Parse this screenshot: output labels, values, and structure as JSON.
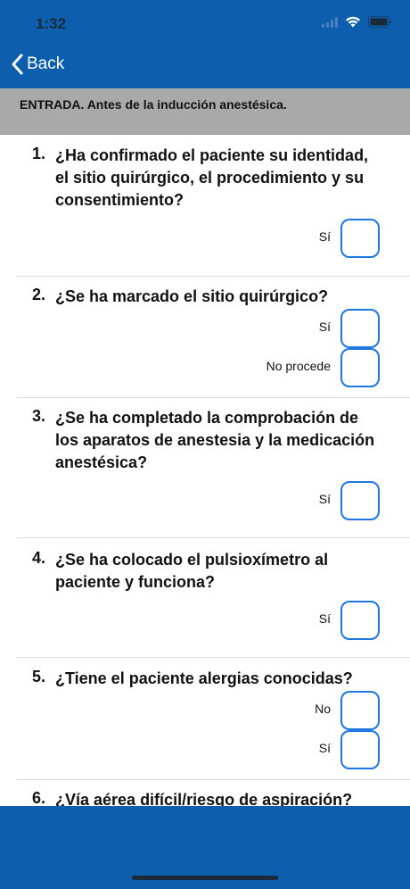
{
  "status_bar": {
    "time": "1:32"
  },
  "nav": {
    "back_label": "Back"
  },
  "section": {
    "title": "ENTRADA. Antes de la inducción anestésica."
  },
  "questions": [
    {
      "number": "1.",
      "lines": [
        "¿Ha confirmado el paciente su identidad,",
        "el sitio quirúrgico, el procedimiento y su",
        "consentimiento?"
      ],
      "options": [
        "Sí"
      ]
    },
    {
      "number": "2.",
      "lines": [
        "¿Se ha marcado el sitio quirúrgico?"
      ],
      "options": [
        "Sí",
        "No procede"
      ]
    },
    {
      "number": "3.",
      "lines": [
        "¿Se ha completado la comprobación de",
        "los aparatos de anestesia y la medicación",
        "anestésica?"
      ],
      "options": [
        "Sí"
      ]
    },
    {
      "number": "4.",
      "lines": [
        "¿Se ha colocado el pulsioxímetro al",
        "paciente y funciona?"
      ],
      "options": [
        "Sí"
      ]
    },
    {
      "number": "5.",
      "lines": [
        "¿Tiene el paciente alergias conocidas?"
      ],
      "options": [
        "No",
        "Sí"
      ]
    },
    {
      "number": "6.",
      "lines": [
        "¿Vía aérea difícil/riesgo de aspiración?"
      ],
      "options": []
    }
  ],
  "colors": {
    "primary": "#0d5fae",
    "banner": "#a9a9a9",
    "checkbox_border": "#1f78e0"
  },
  "icons": {
    "back": "chevron-left-icon",
    "wifi": "wifi-icon",
    "battery": "battery-icon",
    "signal": "signal-icon"
  }
}
